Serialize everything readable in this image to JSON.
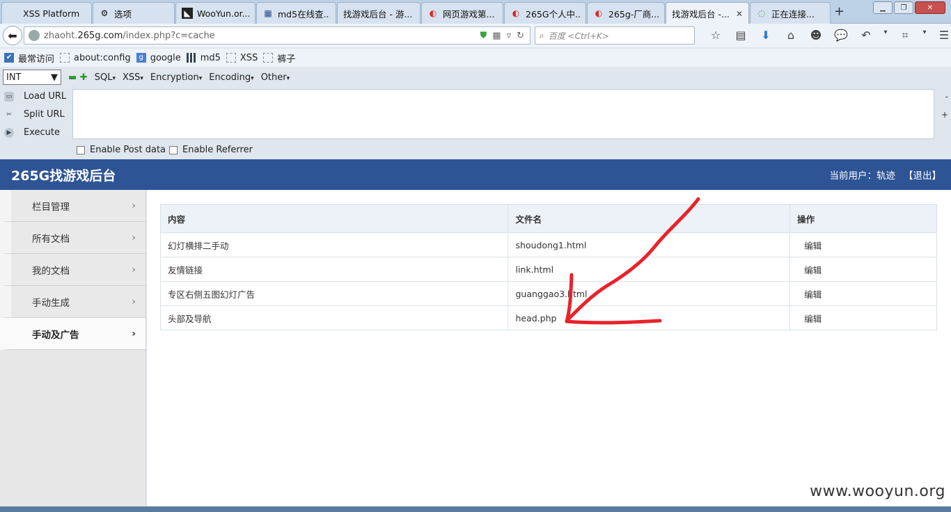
{
  "browser": {
    "tabs": [
      {
        "label": "XSS Platform",
        "icon": "blank-icon"
      },
      {
        "label": "选项",
        "icon": "gear-icon"
      },
      {
        "label": "WooYun.or...",
        "icon": "wooyun-icon"
      },
      {
        "label": "md5在线查...",
        "icon": "grid-icon"
      },
      {
        "label": "找游戏后台 - 游...",
        "icon": "blank-icon"
      },
      {
        "label": "网页游戏第...",
        "icon": "265g-icon"
      },
      {
        "label": "265G个人中...",
        "icon": "265g-icon"
      },
      {
        "label": "265g-厂商...",
        "icon": "265g-icon"
      },
      {
        "label": "找游戏后台 -...",
        "icon": "blank-icon",
        "active": true
      },
      {
        "label": "正在连接...",
        "icon": "loading-icon"
      }
    ],
    "url_prefix": "zhaoht.",
    "url_domain": "265g.com",
    "url_path": "/index.php?c=cache",
    "search_placeholder": "百度 <Ctrl+K>",
    "bookmarks": [
      {
        "label": "最常访问",
        "icon": "most-visited-icon"
      },
      {
        "label": "about:config",
        "icon": "page-icon"
      },
      {
        "label": "google",
        "icon": "google-icon"
      },
      {
        "label": "md5",
        "icon": "grid-icon"
      },
      {
        "label": "XSS",
        "icon": "page-icon"
      },
      {
        "label": "裤子",
        "icon": "page-icon"
      }
    ]
  },
  "hackbar": {
    "select_value": "INT",
    "menus": [
      "SQL",
      "XSS",
      "Encryption",
      "Encoding",
      "Other"
    ],
    "actions": [
      "Load URL",
      "Split URL",
      "Execute"
    ],
    "textarea_value": "",
    "enable_post": "Enable Post data",
    "enable_referrer": "Enable Referrer"
  },
  "page": {
    "title": "265G找游戏后台",
    "current_user": "当前用户：轨迹",
    "logout": "【退出】",
    "sidebar": [
      {
        "label": "栏目管理"
      },
      {
        "label": "所有文档"
      },
      {
        "label": "我的文档"
      },
      {
        "label": "手动生成"
      },
      {
        "label": "手动及广告",
        "active": true
      }
    ],
    "table": {
      "headers": [
        "内容",
        "文件名",
        "操作"
      ],
      "rows": [
        {
          "content": "幻灯横排二手动",
          "filename": "shoudong1.html",
          "action": "编辑"
        },
        {
          "content": "友情链接",
          "filename": "link.html",
          "action": "编辑"
        },
        {
          "content": "专区右侧五图幻灯广告",
          "filename": "guanggao3.html",
          "action": "编辑"
        },
        {
          "content": "头部及导航",
          "filename": "head.php",
          "action": "编辑"
        }
      ]
    }
  },
  "watermark": "www.wooyun.org",
  "colors": {
    "header_bg": "#2d5495",
    "annotation_red": "#e8232a"
  }
}
